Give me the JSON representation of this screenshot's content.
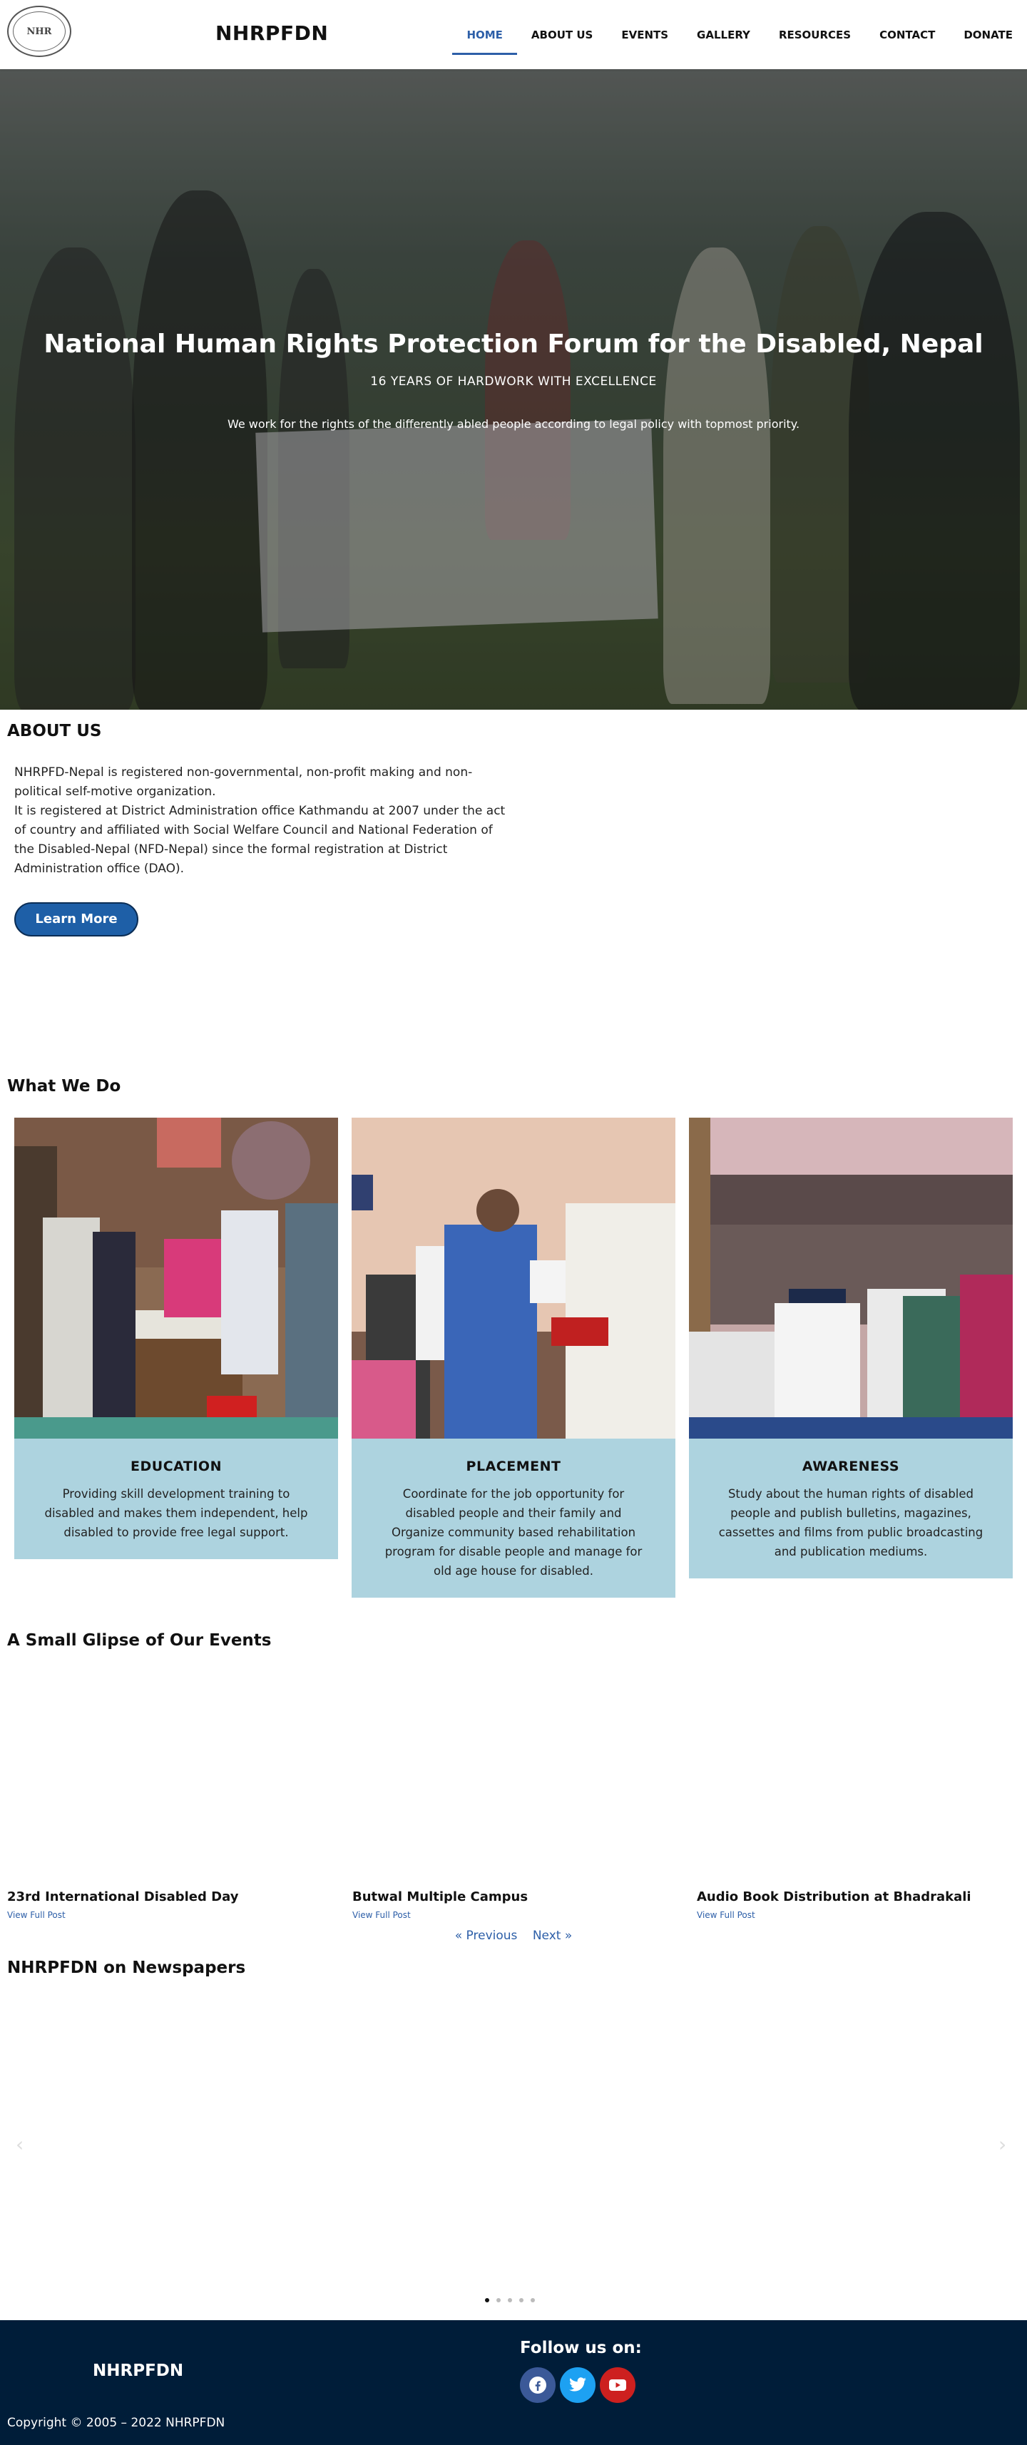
{
  "header": {
    "logo_text": "NHR",
    "site_title": "NHRPFDN",
    "nav": [
      {
        "label": "HOME",
        "active": true
      },
      {
        "label": "ABOUT US",
        "active": false
      },
      {
        "label": "EVENTS",
        "active": false
      },
      {
        "label": "GALLERY",
        "active": false
      },
      {
        "label": "RESOURCES",
        "active": false
      },
      {
        "label": "CONTACT",
        "active": false
      },
      {
        "label": "DONATE",
        "active": false
      }
    ]
  },
  "hero": {
    "title": "National Human Rights Protection Forum for the Disabled, Nepal",
    "subtitle": "16 YEARS OF HARDWORK WITH EXCELLENCE",
    "text": "We work for the rights of the differently abled people according to legal policy with topmost priority."
  },
  "about": {
    "heading": "ABOUT US",
    "paragraphs": [
      "NHRPFD-Nepal is registered non-governmental, non-profit making and non-political self-motive organization.",
      "It is registered at District Administration office Kathmandu at 2007 under the act of country and affiliated with Social Welfare Council and National Federation of the Disabled-Nepal (NFD-Nepal) since the formal registration at District Administration office (DAO)."
    ],
    "button": "Learn More"
  },
  "what_we_do": {
    "heading": "What We Do",
    "cards": [
      {
        "title": "EDUCATION",
        "text": "Providing skill development training to disabled and makes them independent, help disabled to provide free legal support."
      },
      {
        "title": "PLACEMENT",
        "text": "Coordinate for the job opportunity for disabled people and their family and Organize community based rehabilitation program for disable people and manage for old age house for disabled."
      },
      {
        "title": "AWARENESS",
        "text": "Study about the human rights of disabled people and publish bulletins, magazines, cassettes and films from public broadcasting and publication mediums."
      }
    ]
  },
  "events": {
    "heading": "A Small Glipse of Our Events",
    "items": [
      {
        "title": "23rd International Disabled Day",
        "link": "View Full Post"
      },
      {
        "title": "Butwal Multiple Campus",
        "link": "View Full Post"
      },
      {
        "title": "Audio Book Distribution at Bhadrakali",
        "link": "View Full Post"
      }
    ],
    "prev": "« Previous",
    "next": "Next »"
  },
  "newspapers": {
    "heading": "NHRPFDN on Newspapers",
    "prev_arrow": "‹",
    "next_arrow": "›",
    "slide_count": 5,
    "active_slide": 1
  },
  "footer": {
    "name": "NHRPFDN",
    "follow": "Follow us on:",
    "social": [
      {
        "name": "facebook-icon",
        "color": "#3b5998"
      },
      {
        "name": "twitter-icon",
        "color": "#1da1f2"
      },
      {
        "name": "youtube-icon",
        "color": "#cd201f"
      }
    ],
    "copyright": "Copyright © 2005 – 2022 NHRPFDN"
  },
  "colors": {
    "accent": "#2d5fa8",
    "card_bg": "#add3df",
    "footer_bg": "#001d39",
    "button_bg": "#1e5fa7"
  }
}
